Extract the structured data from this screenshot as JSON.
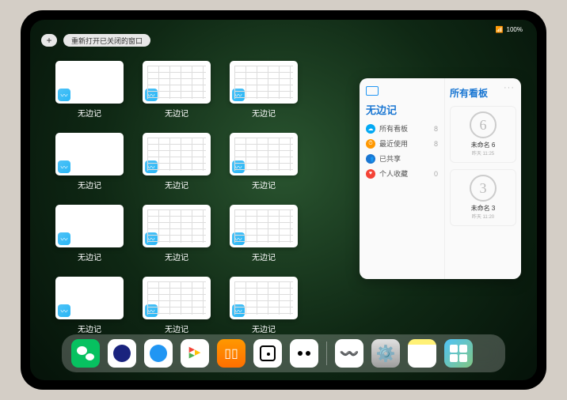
{
  "statusbar": {
    "signal": "📶",
    "battery": "100%"
  },
  "topbar": {
    "plus": "+",
    "banner": "重新打开已关闭的窗口"
  },
  "app_label": "无边记",
  "thumbs": [
    {
      "variant": "blank"
    },
    {
      "variant": "grid"
    },
    {
      "variant": "grid"
    },
    {
      "variant": "blank"
    },
    {
      "variant": "grid"
    },
    {
      "variant": "grid"
    },
    {
      "variant": "blank"
    },
    {
      "variant": "grid"
    },
    {
      "variant": "grid"
    },
    {
      "variant": "blank"
    },
    {
      "variant": "grid"
    },
    {
      "variant": "grid"
    }
  ],
  "panel": {
    "title": "无边记",
    "right_title": "所有看板",
    "more": "···",
    "sidebar": [
      {
        "icon": "☁",
        "color": "#03a9f4",
        "label": "所有看板",
        "count": "8"
      },
      {
        "icon": "⏱",
        "color": "#ff9800",
        "label": "最近使用",
        "count": "8"
      },
      {
        "icon": "👥",
        "color": "#1976d2",
        "label": "已共享",
        "count": ""
      },
      {
        "icon": "♥",
        "color": "#f44336",
        "label": "个人收藏",
        "count": "0"
      }
    ],
    "boards": [
      {
        "sketch": "6",
        "name": "未命名 6",
        "sub": "昨天 11:25"
      },
      {
        "sketch": "3",
        "name": "未命名 3",
        "sub": "昨天 11:20"
      }
    ]
  },
  "dock": [
    {
      "name": "wechat-icon"
    },
    {
      "name": "app2-icon"
    },
    {
      "name": "app3-icon"
    },
    {
      "name": "play-icon"
    },
    {
      "name": "books-icon"
    },
    {
      "name": "dice-icon"
    },
    {
      "name": "dots-icon"
    },
    {
      "name": "sep"
    },
    {
      "name": "freeform-icon"
    },
    {
      "name": "settings-icon"
    },
    {
      "name": "notes-icon"
    },
    {
      "name": "folder-icon"
    }
  ]
}
